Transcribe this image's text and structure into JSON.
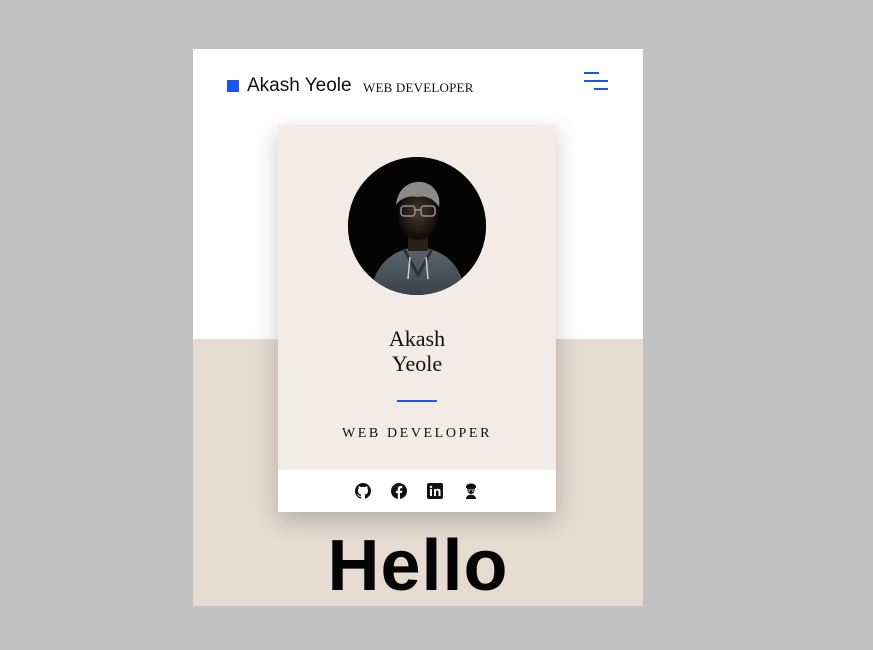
{
  "header": {
    "brand_name": "Akash Yeole",
    "brand_role": "WEB DEVELOPER",
    "menu_icon": "menu-lines-icon"
  },
  "card": {
    "avatar_icon": "profile-photo",
    "name_line1": "Akash",
    "name_line2": "Yeole",
    "role": "WEB DEVELOPER",
    "social": [
      "github-icon",
      "facebook-icon",
      "linkedin-icon",
      "codechef-icon"
    ]
  },
  "main": {
    "heading": "Hello"
  },
  "colors": {
    "accent": "#1a56f5",
    "card_bg": "#f3ebe5",
    "lower_band": "#e5dbd1",
    "outer_bg": "#c2c2c2"
  }
}
